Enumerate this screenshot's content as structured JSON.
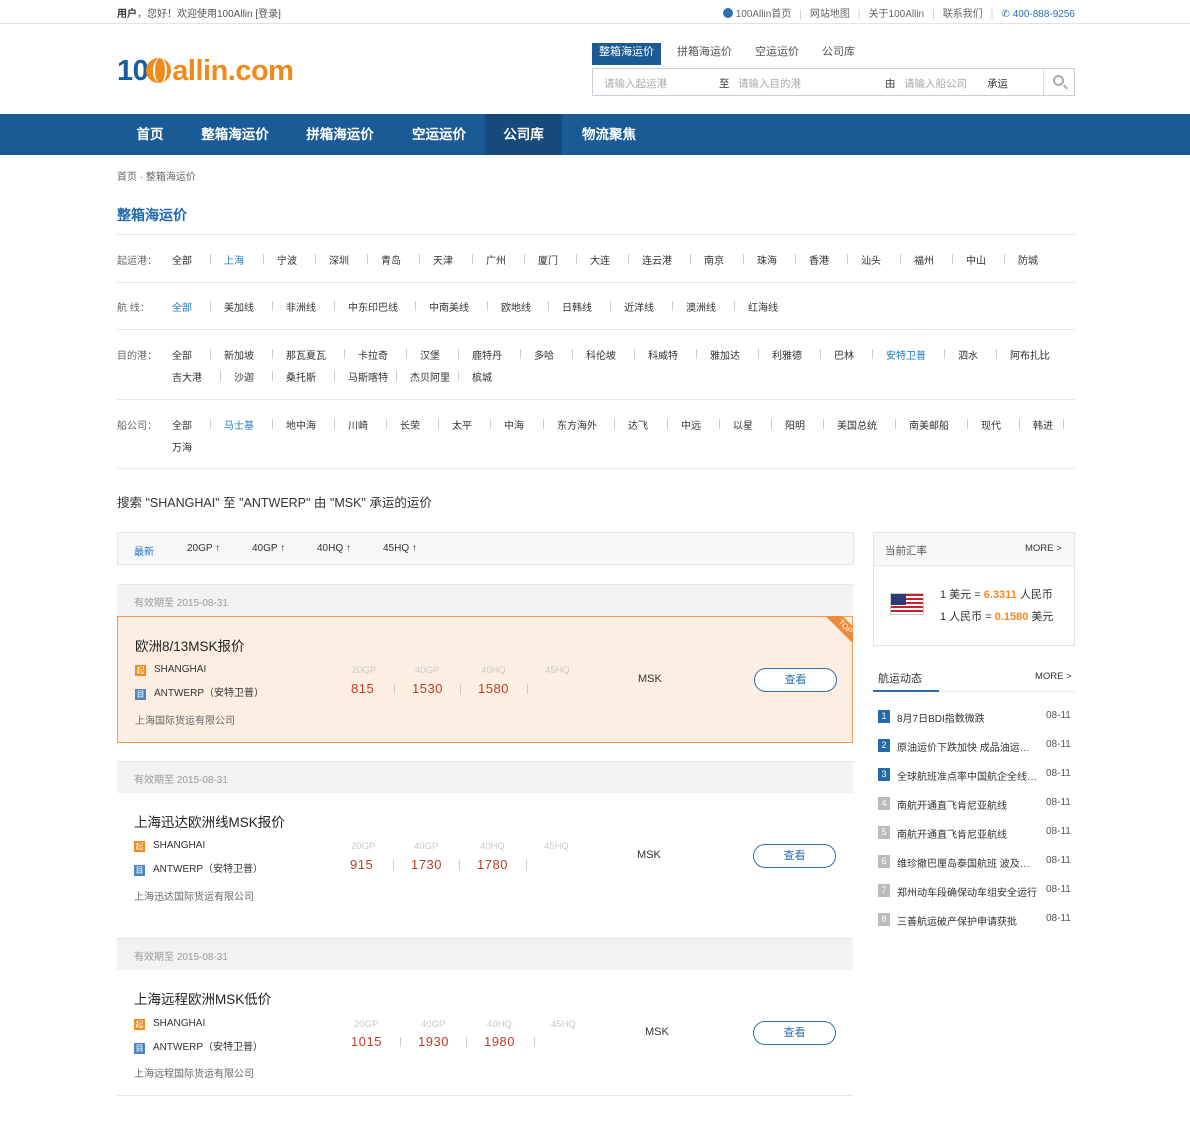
{
  "topbar": {
    "greeting_user": "用户",
    "greeting_text": "，您好！欢迎使用100Allin [登录]",
    "links": [
      "100Allin首页",
      "网站地图",
      "关于100Allin",
      "联系我们"
    ],
    "phone": "400-888-9256"
  },
  "logo": {
    "part1": "10",
    "part2": "allin.com"
  },
  "search": {
    "tabs": [
      "整箱海运价",
      "拼箱海运价",
      "空运运价",
      "公司库"
    ],
    "from_placeholder": "请输入起运港",
    "to_word": "至",
    "to_placeholder": "请输入目的港",
    "by_word": "由",
    "carrier_placeholder": "请输入船公司",
    "suffix": "承运"
  },
  "nav": [
    "首页",
    "整箱海运价",
    "拼箱海运价",
    "空运运价",
    "公司库",
    "物流聚焦"
  ],
  "breadcrumb": "首页 · 整箱海运价",
  "page_title": "整箱海运价",
  "filters": {
    "origin": {
      "label": "起运港：",
      "options": [
        "全部",
        "上海",
        "宁波",
        "深圳",
        "青岛",
        "天津",
        "广州",
        "厦门",
        "大连",
        "连云港",
        "南京",
        "珠海",
        "香港",
        "汕头",
        "福州",
        "中山",
        "防城"
      ]
    },
    "route": {
      "label": "航  线：",
      "options": [
        "全部",
        "美加线",
        "非洲线",
        "中东印巴线",
        "中南美线",
        "欧地线",
        "日韩线",
        "近洋线",
        "澳洲线",
        "红海线"
      ]
    },
    "dest": {
      "label": "目的港：",
      "options": [
        "全部",
        "新加坡",
        "那瓦夏瓦",
        "卡拉奇",
        "汉堡",
        "鹿特丹",
        "多哈",
        "科伦坡",
        "科威特",
        "雅加达",
        "利雅德",
        "巴林",
        "安特卫普",
        "泗水",
        "阿布扎比",
        "吉大港",
        "沙迦",
        "桑托斯",
        "马斯喀特",
        "杰贝阿里",
        "槟城"
      ]
    },
    "carrier": {
      "label": "船公司：",
      "options": [
        "全部",
        "马士基",
        "地中海",
        "川崎",
        "长荣",
        "太平",
        "中海",
        "东方海外",
        "达飞",
        "中远",
        "以星",
        "阳明",
        "美国总统",
        "南美邮船",
        "现代",
        "韩进",
        "万海"
      ]
    }
  },
  "query_text": "搜索 \"SHANGHAI\" 至 \"ANTWERP\" 由 \"MSK\" 承运的运价",
  "sort": [
    "最新",
    "20GP ↑",
    "40GP ↑",
    "40HQ ↑",
    "45HQ ↑"
  ],
  "container_labels": [
    "20GP",
    "40GP",
    "40HQ",
    "45HQ"
  ],
  "results": [
    {
      "validity": "有效期至 2015-08-31",
      "title": "欧洲8/13MSK报价",
      "origin_icon": "起",
      "origin": "SHANGHAI",
      "dest_icon": "目",
      "dest": "ANTWERP（安特卫普）",
      "prices": [
        "815",
        "1530",
        "1580"
      ],
      "carrier": "MSK",
      "button": "查看",
      "company": "上海国际货运有限公司",
      "badge": "TOP",
      "highlight": true
    },
    {
      "validity": "有效期至 2015-08-31",
      "title": "上海迅达欧洲线MSK报价",
      "origin_icon": "起",
      "origin": "SHANGHAI",
      "dest_icon": "目",
      "dest": "ANTWERP（安特卫普）",
      "prices": [
        "915",
        "1730",
        "1780"
      ],
      "carrier": "MSK",
      "button": "查看",
      "company": "上海迅达国际货运有限公司",
      "highlight": false
    },
    {
      "validity": "有效期至 2015-08-31",
      "title": "上海远程欧洲MSK低价",
      "origin_icon": "起",
      "origin": "SHANGHAI",
      "dest_icon": "目",
      "dest": "ANTWERP（安特卫普）",
      "prices": [
        "1015",
        "1930",
        "1980"
      ],
      "carrier": "MSK",
      "button": "查看",
      "company": "上海远程国际货运有限公司",
      "highlight": false
    }
  ],
  "exchange": {
    "title": "当前汇率",
    "more": "MORE >",
    "line1_pre": "1 美元 = ",
    "line1_val": "6.3311",
    "line1_post": " 人民币",
    "line2_pre": "1 人民币 = ",
    "line2_val": "0.1580",
    "line2_post": " 美元"
  },
  "news": {
    "title": "航运动态",
    "more": "MORE >",
    "items": [
      {
        "num": "1",
        "text": "8月7日BDI指数微跌",
        "date": "08-11"
      },
      {
        "num": "2",
        "text": "原油运价下跌加快 成品油运价走低",
        "date": "08-11"
      },
      {
        "num": "3",
        "text": "全球航班准点率中国航企全线垫底",
        "date": "08-11"
      },
      {
        "num": "4",
        "text": "南航开通直飞肯尼亚航线",
        "date": "08-11"
      },
      {
        "num": "5",
        "text": "南航开通直飞肯尼亚航线",
        "date": "08-11"
      },
      {
        "num": "6",
        "text": "维珍撤巴厘岛泰国航班 波及多条航线",
        "date": "08-11"
      },
      {
        "num": "7",
        "text": "郑州动车段确保动车组安全运行",
        "date": "08-11"
      },
      {
        "num": "8",
        "text": "三善航运破产保护申请获批",
        "date": "08-11"
      }
    ]
  }
}
